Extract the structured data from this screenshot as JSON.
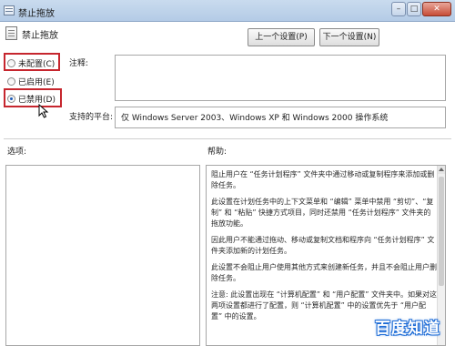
{
  "window": {
    "title": "禁止拖放"
  },
  "header": {
    "policy_name": "禁止拖放",
    "prev_button": "上一个设置(P)",
    "next_button": "下一个设置(N)"
  },
  "state": {
    "options": [
      {
        "label": "未配置(C)",
        "checked": false
      },
      {
        "label": "已启用(E)",
        "checked": false
      },
      {
        "label": "已禁用(D)",
        "checked": true
      }
    ]
  },
  "comment": {
    "label": "注释:",
    "value": ""
  },
  "platform": {
    "label": "支持的平台:",
    "value": "仅 Windows Server 2003、Windows XP 和 Windows 2000 操作系统"
  },
  "options_panel": {
    "label": "选项:"
  },
  "help": {
    "label": "帮助:",
    "paragraphs": [
      "阻止用户在 “任务计划程序” 文件夹中通过移动或复制程序来添加或删除任务。",
      "此设置在计划任务中的上下文菜单和 “编辑” 菜单中禁用 “剪切”、“复制” 和 “粘贴” 快捷方式项目，同时还禁用 “任务计划程序” 文件夹的拖放功能。",
      "因此用户不能通过拖动、移动或复制文档和程序向 “任务计划程序” 文件夹添加新的计划任务。",
      "此设置不会阻止用户使用其他方式来创建新任务，并且不会阻止用户删除任务。",
      "注意: 此设置出现在 “计算机配置” 和 “用户配置” 文件夹中。如果对这两项设置都进行了配置，则 “计算机配置” 中的设置优先于 “用户配置” 中的设置。"
    ]
  },
  "watermark": "百度知道",
  "colors": {
    "highlight": "#c6262e",
    "titlebar": "#b4cbe6",
    "watermark": "#1c6bd6"
  }
}
